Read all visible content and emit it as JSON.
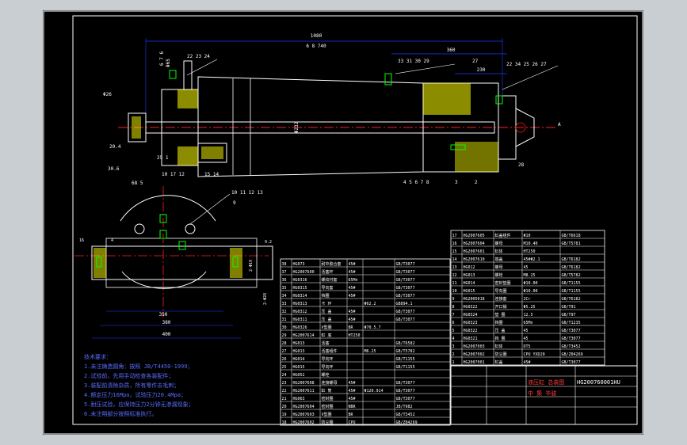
{
  "drawing": {
    "drawing_number": "HG200760001HU",
    "title_lines": [
      "液压缸 总装图",
      "中 集 华骏"
    ],
    "colors": {
      "background": "#000000",
      "frame": "#ffffff",
      "contour": "#ffffff",
      "dimension": "#1e3cff",
      "centerline": "#ff2020",
      "hatch": "#ffff00",
      "part": "#00ff00",
      "balloon": "#00ffff"
    }
  },
  "dimensions": {
    "overall_length": "1080",
    "stroke": "6 8 740",
    "right_span": "360",
    "mid_span": "230",
    "bore": "Φ232",
    "flange_dia": "Φ65",
    "end_a": "Φ26",
    "end_b": "20.4",
    "bottom_a": "30.6",
    "bottom_b": "68 5",
    "bottom_c": "25 1",
    "base_width": "350",
    "base_overall": "380",
    "base_total": "400",
    "side_a": "9.2",
    "side_b": "2-Φ19",
    "side_c": "2-Φ28",
    "side_d": "16",
    "side_e": "4",
    "callout_a": "A"
  },
  "balloons": {
    "top_left": "22 23 24",
    "top_right": "33 31 30 29",
    "top_right2": "27",
    "top_far": "22 34 25 26 27",
    "side_stack": "12 13 14",
    "bottom_row": "4 5 6 7 8",
    "bottom_pair": "3",
    "bottom_single": "2",
    "bottom_left1": "10 17 12",
    "bottom_left2": "15 14",
    "view_top": "10 11 12 13",
    "view_mid": "9",
    "view_right": "28",
    "flange_left": "6 7 6",
    "right_end": "A"
  },
  "notes": {
    "header": "技术要求：",
    "items": [
      "1.未注铸造圆角：按照 JB/T4450-1999；",
      "2.试验前，先用手动检查各装配件；",
      "3.装配前清除杂质，所有零件去毛刺；",
      "4.额定压力16Mpa，试验压力20.4Mpa；",
      "5.耐压试验，应保持压力2分钟无渗漏现象；",
      "6.未注明部分按照标准执行。"
    ]
  },
  "parts_left": {
    "rows": [
      [
        "38",
        "HG073",
        "耐中胶合套",
        "45#",
        "",
        "GB/T3077"
      ],
      [
        "37",
        "HG2007600",
        "活塞杆",
        "45#",
        "",
        "GB/T3077"
      ],
      [
        "36",
        "HG0316",
        "螺纹衬套",
        "65Mn",
        "",
        "GB/T3077"
      ],
      [
        "35",
        "HG0315",
        "导向套",
        "45#",
        "",
        "GB/T3077"
      ],
      [
        "34",
        "HG0314",
        "挡圈",
        "45#",
        "",
        "GB/T3077"
      ],
      [
        "33",
        "HG0313",
        "卡 环",
        "",
        "Φ62.2",
        "GB894.1"
      ],
      [
        "32",
        "HG0312",
        "压 盖",
        "45#",
        "",
        "GB/T3077"
      ],
      [
        "31",
        "HG0311",
        "压 盖",
        "45#",
        "",
        "GB/T3077"
      ],
      [
        "30",
        "HG0326",
        "V型圈",
        "BR",
        "Φ70.5.7",
        ""
      ],
      [
        "29",
        "HG2007614",
        "缸 底",
        "HT250",
        "",
        ""
      ],
      [
        "28",
        "HG013",
        "活塞",
        "",
        "",
        "GB/T6582"
      ],
      [
        "27",
        "HG013",
        "活塞组件",
        "",
        "M6.25",
        "GB/T5782"
      ],
      [
        "26",
        "HG014",
        "导向环",
        "",
        "",
        "GB/T1155"
      ],
      [
        "25",
        "HG015",
        "导向环",
        "",
        "",
        "GB/T1155"
      ],
      [
        "24",
        "HG052",
        "螺栓",
        "",
        "",
        ""
      ],
      [
        "23",
        "HG2007608",
        "连接螺母",
        "45#",
        "",
        "GB/T3077"
      ],
      [
        "22",
        "HG2007611",
        "缸 筒",
        "45#",
        "Φ120.914",
        "GB/T3077"
      ],
      [
        "21",
        "HG063",
        "密封圈",
        "45#",
        "",
        "GB/T3077"
      ],
      [
        "20",
        "HG2007604",
        "密封圈",
        "NBR",
        "",
        "JB/T982"
      ],
      [
        "19",
        "HG2007603",
        "V型圈",
        "BR",
        "",
        "GB/T3452"
      ],
      [
        "18",
        "HG2007602",
        "防尘圈",
        "CPU",
        "",
        "GB/Z04269"
      ]
    ]
  },
  "parts_right": {
    "rows": [
      [
        "17",
        "HG2007605",
        "缸盖组件",
        "Φ10",
        "GB/T6618"
      ],
      [
        "16",
        "HG2007604",
        "螺母",
        "M10.40",
        "GB/T5781"
      ],
      [
        "15",
        "HG2007601",
        "缸体",
        "HT250",
        ""
      ],
      [
        "14",
        "HG2007610",
        "端盖",
        "45#Φ2.1",
        "GB/T6182"
      ],
      [
        "13",
        "HG012",
        "螺母",
        "45",
        "GB/T6182"
      ],
      [
        "12",
        "HG013",
        "螺栓",
        "M8.25",
        "GB/T5782"
      ],
      [
        "11",
        "HG014",
        "密封垫圈",
        "Φ10.00",
        "GB/T1155"
      ],
      [
        "10",
        "HG015",
        "导向圈",
        "Φ10.00",
        "GB/T1155"
      ],
      [
        "9",
        "HG2005018",
        "连接套",
        "2Cr",
        "GB/T6182"
      ],
      [
        "8",
        "HG0322",
        "开口销",
        "Φ5.25",
        "GB/T91"
      ],
      [
        "7",
        "HG0324",
        "垫 圈",
        "12.5",
        "GB/T97"
      ],
      [
        "6",
        "HG0323",
        "挡圈",
        "65Mn",
        "GB/T1235"
      ],
      [
        "5",
        "HG0322",
        "压 盖",
        "45",
        "GB/T3077"
      ],
      [
        "4",
        "HG0321",
        "挡 圈",
        "45",
        "GB/T3077"
      ],
      [
        "3",
        "HG2007003",
        "缸体",
        "DT5",
        "GB/T3452"
      ],
      [
        "2",
        "HG2007002",
        "防尘圈",
        "CPU YXD20",
        "GB/Z04269"
      ],
      [
        "1",
        "HG2007001",
        "缸盖",
        "45#",
        "GB/T3077"
      ]
    ]
  }
}
